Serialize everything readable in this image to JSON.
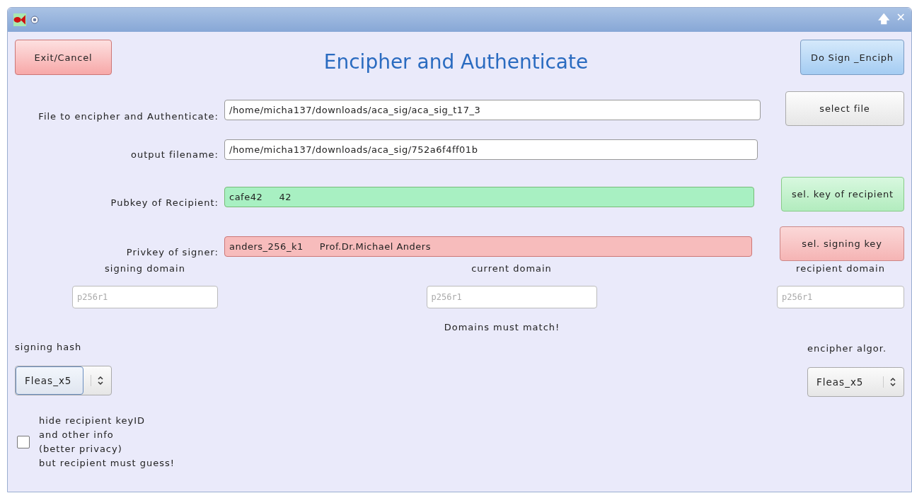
{
  "window": {
    "title_bar_buttons": [
      "🡅",
      "✕"
    ]
  },
  "header": {
    "title": "Encipher and Authenticate",
    "buttons": [
      {
        "label": "Exit/Cancel",
        "kind": "cancel"
      },
      {
        "label": "Do Sign _Enciph",
        "kind": "primary"
      }
    ]
  },
  "rows": [
    {
      "label": "File to encipher and Authenticate:",
      "value": "/home/micha137/downloads/aca_sig/aca_sig_t17_3",
      "kind": "plain",
      "button": {
        "label": "select file",
        "kind": "plain"
      }
    },
    {
      "label": "output filename:",
      "value": "/home/micha137/downloads/aca_sig/752a6f4ff01b",
      "kind": "plain"
    },
    {
      "label": "Pubkey of Recipient:",
      "value": "cafe42     42",
      "kind": "valid",
      "button": {
        "label": "sel. key of recipient",
        "kind": "valid"
      }
    },
    {
      "label": "Privkey of signer:",
      "value": "anders_256_k1     Prof.Dr.Michael Anders",
      "kind": "invalid",
      "button": {
        "label": "sel. signing key",
        "kind": "invalid"
      }
    }
  ],
  "domains": [
    {
      "label": "signing domain",
      "placeholder": "p256r1"
    },
    {
      "label": "current domain",
      "placeholder": "p256r1"
    },
    {
      "label": "recipient domain",
      "placeholder": "p256r1"
    }
  ],
  "domains_note": "Domains must match!",
  "selects": [
    {
      "label": "signing hash",
      "value": "Fleas_x5",
      "focused": true
    },
    {
      "label": "encipher algor.",
      "value": "Fleas_x5",
      "focused": false
    }
  ],
  "hide_recipient": {
    "lines": [
      "hide recipient keyID",
      "and other info",
      "(better privacy)",
      "but recipient must guess!"
    ],
    "checked": false
  }
}
